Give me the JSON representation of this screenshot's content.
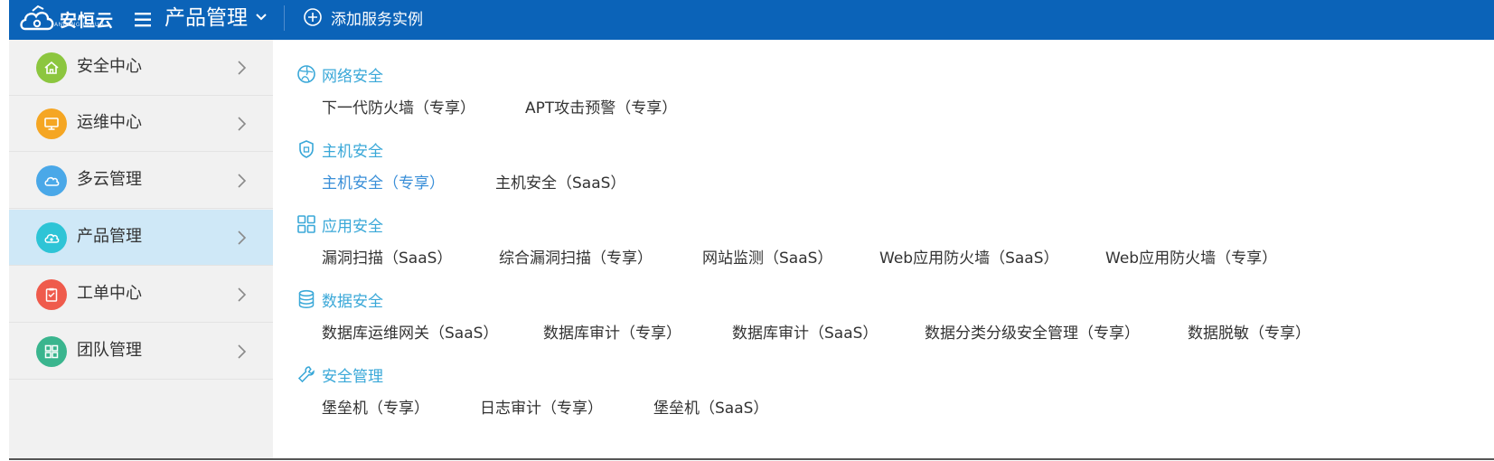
{
  "header": {
    "logo_text": "安恒云",
    "logo_sub": "ANHENG CLOUD",
    "title": "产品管理",
    "add_label": "添加服务实例"
  },
  "sidebar": {
    "items": [
      {
        "label": "安全中心",
        "icon": "home-icon",
        "color": "#8cc63f",
        "active": false
      },
      {
        "label": "运维中心",
        "icon": "monitor-icon",
        "color": "#f5a623",
        "active": false
      },
      {
        "label": "多云管理",
        "icon": "cloud-icon",
        "color": "#4aa8e8",
        "active": false
      },
      {
        "label": "产品管理",
        "icon": "cloud-eye-icon",
        "color": "#2ec4d6",
        "active": true
      },
      {
        "label": "工单中心",
        "icon": "clipboard-icon",
        "color": "#ef5b4c",
        "active": false
      },
      {
        "label": "团队管理",
        "icon": "grid-icon",
        "color": "#3ab58e",
        "active": false
      }
    ]
  },
  "categories": [
    {
      "label": "网络安全",
      "icon": "globe-icon",
      "products": [
        "下一代防火墙（专享）",
        "APT攻击预警（专享）"
      ]
    },
    {
      "label": "主机安全",
      "icon": "shield-icon",
      "products": [
        "主机安全（专享）",
        "主机安全（SaaS）"
      ]
    },
    {
      "label": "应用安全",
      "icon": "apps-icon",
      "products": [
        "漏洞扫描（SaaS）",
        "综合漏洞扫描（专享）",
        "网站监测（SaaS）",
        "Web应用防火墙（SaaS）",
        "Web应用防火墙（专享）"
      ]
    },
    {
      "label": "数据安全",
      "icon": "database-icon",
      "products": [
        "数据库运维网关（SaaS）",
        "数据库审计（专享）",
        "数据库审计（SaaS）",
        "数据分类分级安全管理（专享）",
        "数据脱敏（专享）"
      ]
    },
    {
      "label": "安全管理",
      "icon": "wrench-icon",
      "products": [
        "堡垒机（专享）",
        "日志审计（专享）",
        "堡垒机（SaaS）"
      ]
    }
  ],
  "colors": {
    "topbar": "#0b63b8",
    "accent": "#3aa8d8",
    "highlight_link": "#3a8fd8",
    "active_bg": "#cfe8f7"
  }
}
